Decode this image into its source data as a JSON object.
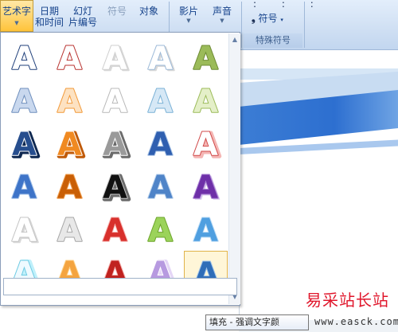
{
  "ribbon": {
    "wordart_label": "艺术字",
    "datetime_line1": "日期",
    "datetime_line2": "和时间",
    "slidenum_line1": "幻灯",
    "slidenum_line2": "片编号",
    "symbol_label": "符号",
    "object_label": "对象",
    "movie_label": "影片",
    "sound_label": "声音",
    "dots": ":  :  :",
    "symbol_button_label": "符号",
    "special_group_label": "特殊符号"
  },
  "gallery": {
    "glyph": "A",
    "styles": [
      {
        "fill": "#ffffff",
        "stroke": "#1f3f7a",
        "shadow": "none"
      },
      {
        "fill": "#ffffff",
        "stroke": "#b8322f",
        "shadow": "none"
      },
      {
        "fill": "#ffffff",
        "stroke": "#cfcfcf",
        "shadow": "soft"
      },
      {
        "fill": "#ffffff",
        "stroke": "#9bb9d8",
        "shadow": "soft"
      },
      {
        "fill": "#9bbb59",
        "stroke": "#6f8c36",
        "shadow": "none"
      },
      {
        "fill": "#c9d8ee",
        "stroke": "#6f8fbd",
        "shadow": "none"
      },
      {
        "fill": "#fde2c2",
        "stroke": "#f29a3a",
        "shadow": "none"
      },
      {
        "fill": "#ffffff",
        "stroke": "#b8b8b8",
        "shadow": "none"
      },
      {
        "fill": "#d6e8f6",
        "stroke": "#7ab1d6",
        "shadow": "none"
      },
      {
        "fill": "#e4efc8",
        "stroke": "#9bbb59",
        "shadow": "none"
      },
      {
        "fill": "#274e8e",
        "stroke": "#ffffff",
        "shadow": "outline-dark"
      },
      {
        "fill": "#f08a22",
        "stroke": "#ffffff",
        "shadow": "outline-orange"
      },
      {
        "fill": "#9a9a9a",
        "stroke": "#ffffff",
        "shadow": "outline-gray"
      },
      {
        "fill": "#2f5fb0",
        "stroke": "#aac4e6",
        "shadow": "none"
      },
      {
        "fill": "#ffffff",
        "stroke": "#d04848",
        "shadow": "outline-red"
      },
      {
        "fill": "#3e74c8",
        "stroke": "#a3c0e8",
        "shadow": "none"
      },
      {
        "fill": "#c95f06",
        "stroke": "#f2a458",
        "shadow": "none"
      },
      {
        "fill": "#111111",
        "stroke": "#c8c8c8",
        "shadow": "outline-gray"
      },
      {
        "fill": "#4f84c8",
        "stroke": "#b9d1ec",
        "shadow": "none"
      },
      {
        "fill": "#6e2fa8",
        "stroke": "#a77fd1",
        "shadow": "reflect"
      },
      {
        "fill": "#ffffff",
        "stroke": "#c4c4c4",
        "shadow": "soft"
      },
      {
        "fill": "#e8e8e8",
        "stroke": "#a6a6a6",
        "shadow": "none"
      },
      {
        "fill": "#d8302c",
        "stroke": "#f6b3b0",
        "shadow": "none"
      },
      {
        "fill": "#9bd35a",
        "stroke": "#6da52c",
        "shadow": "none"
      },
      {
        "fill": "#4f9fe0",
        "stroke": "#bcdcf6",
        "shadow": "none"
      },
      {
        "fill": "#eefaff",
        "stroke": "#6ecbe3",
        "shadow": "glow-cyan"
      },
      {
        "fill": "#f4a440",
        "stroke": "#ffd38a",
        "shadow": "none"
      },
      {
        "fill": "#c0221f",
        "stroke": "#f4b0ad",
        "shadow": "none"
      },
      {
        "fill": "#b79ae0",
        "stroke": "#ffffff",
        "shadow": "glow-purple"
      },
      {
        "fill": "#2f6db8",
        "stroke": "#9dc1ea",
        "shadow": "none"
      }
    ]
  },
  "tooltip": {
    "text": "填充 - 强调文字颜"
  },
  "watermark": {
    "brand": "易采站长站",
    "url": "www.easck.com"
  }
}
